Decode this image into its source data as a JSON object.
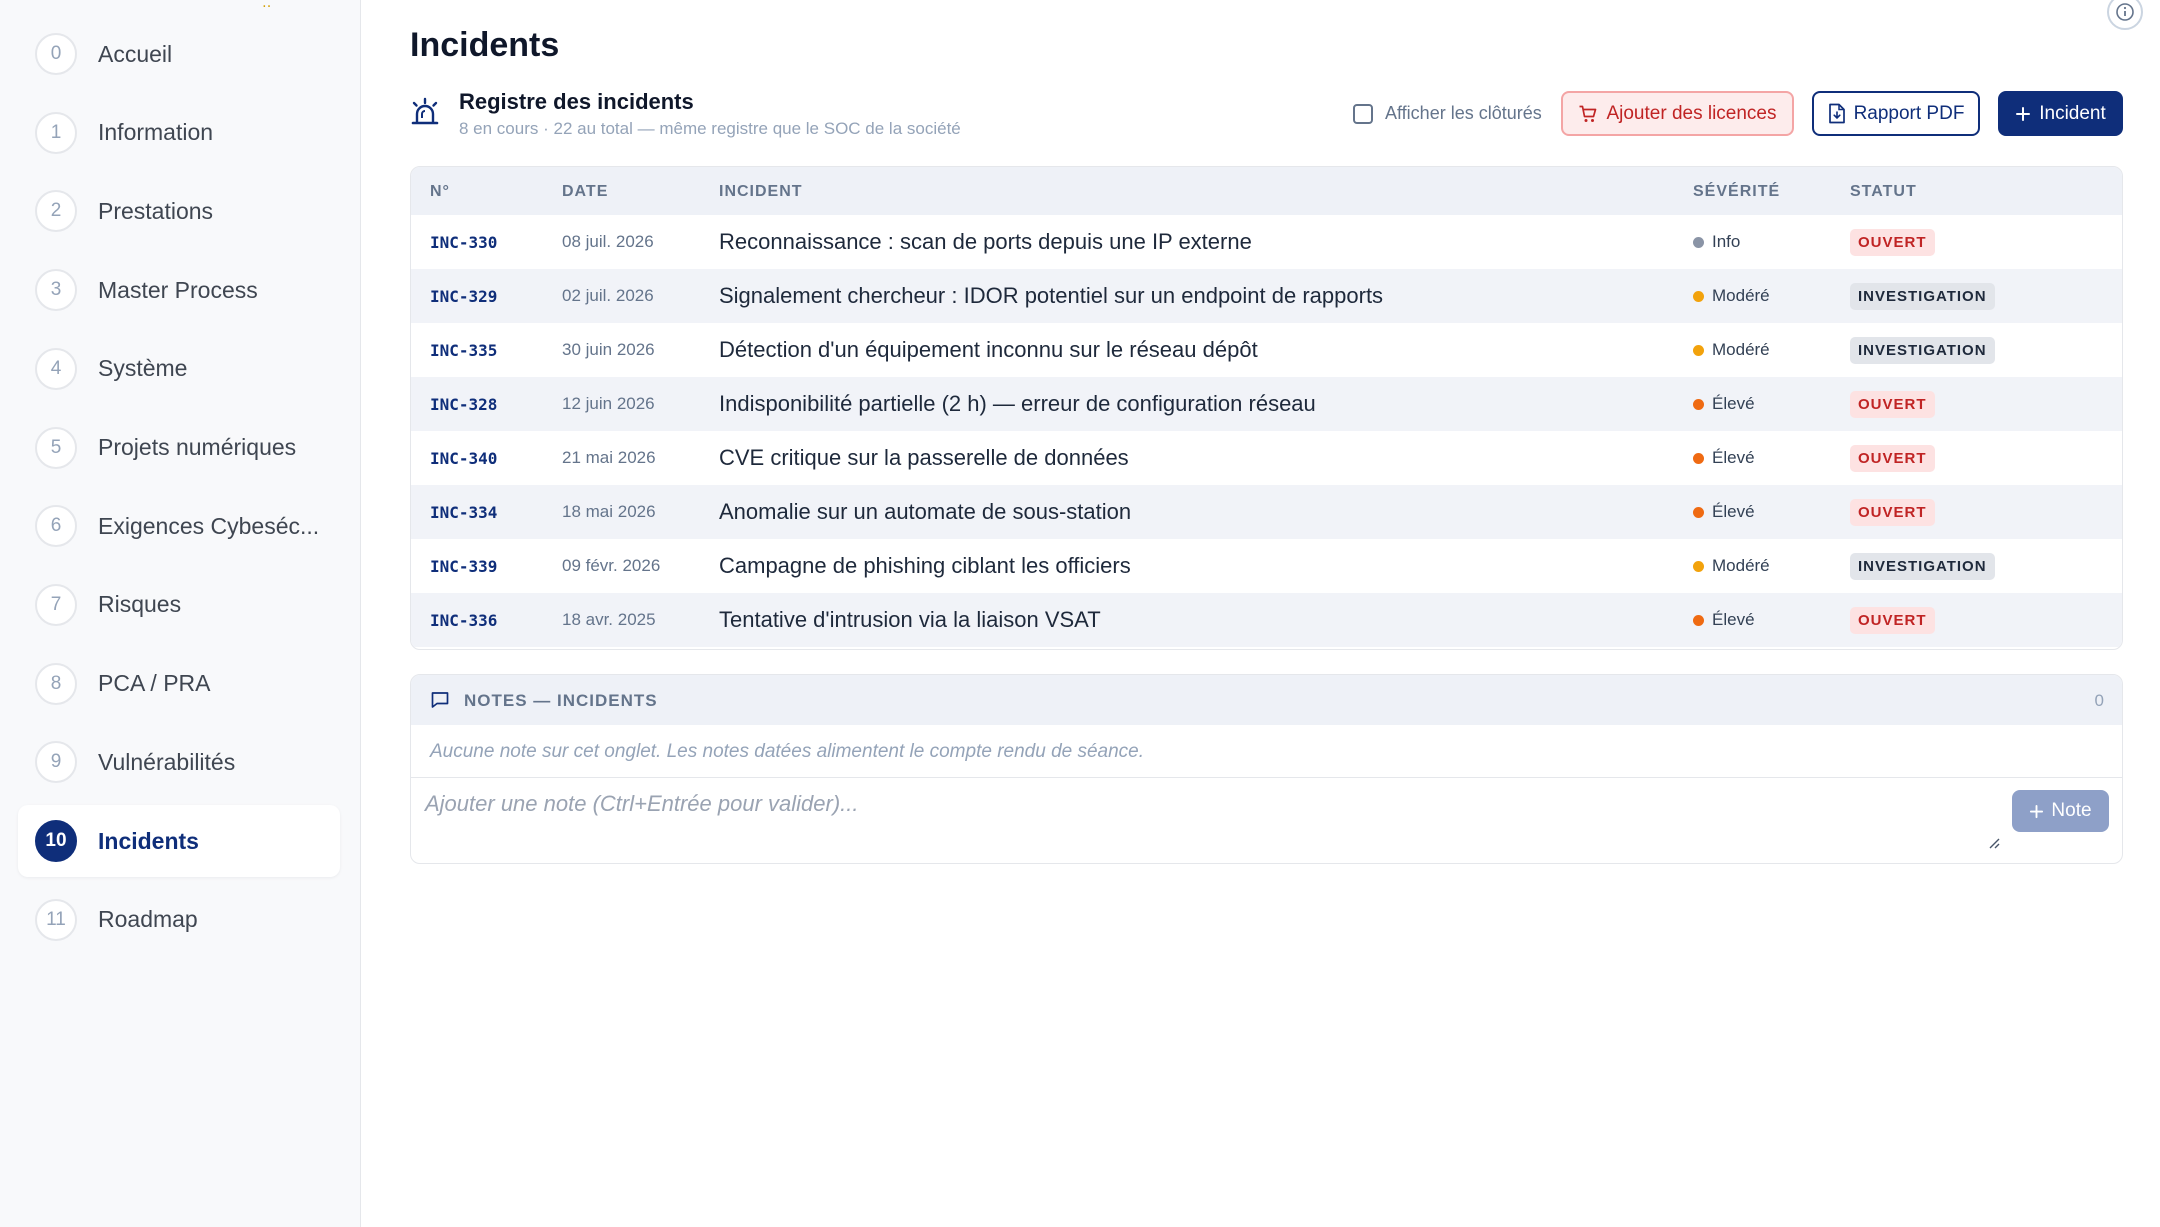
{
  "sidebar": {
    "items": [
      {
        "num": "0",
        "label": "Accueil"
      },
      {
        "num": "1",
        "label": "Information"
      },
      {
        "num": "2",
        "label": "Prestations"
      },
      {
        "num": "3",
        "label": "Master Process"
      },
      {
        "num": "4",
        "label": "Système"
      },
      {
        "num": "5",
        "label": "Projets numériques"
      },
      {
        "num": "6",
        "label": "Exigences Cybeséc..."
      },
      {
        "num": "7",
        "label": "Risques"
      },
      {
        "num": "8",
        "label": "PCA / PRA"
      },
      {
        "num": "9",
        "label": "Vulnérabilités"
      },
      {
        "num": "10",
        "label": "Incidents",
        "active": true
      },
      {
        "num": "11",
        "label": "Roadmap"
      }
    ]
  },
  "page": {
    "title": "Incidents"
  },
  "register": {
    "title": "Registre des incidents",
    "subtitle": "8 en cours · 22 au total — même registre que le SOC de la société",
    "show_closed_label": "Afficher les clôturés",
    "show_closed_checked": false,
    "add_licenses_label": "Ajouter des licences",
    "pdf_label": "Rapport PDF",
    "new_incident_label": "Incident"
  },
  "table": {
    "headers": {
      "id": "N°",
      "date": "DATE",
      "incident": "INCIDENT",
      "severity": "SÉVÉRITÉ",
      "status": "STATUT"
    },
    "rows": [
      {
        "id": "INC-330",
        "date": "08 juil. 2026",
        "incident": "Reconnaissance : scan de ports depuis une IP externe",
        "severity": "Info",
        "severity_color": "#8a94a6",
        "status": "OUVERT",
        "status_kind": "ouvert"
      },
      {
        "id": "INC-329",
        "date": "02 juil. 2026",
        "incident": "Signalement chercheur : IDOR potentiel sur un endpoint de rapports",
        "severity": "Modéré",
        "severity_color": "#f2a20c",
        "status": "INVESTIGATION",
        "status_kind": "investigation"
      },
      {
        "id": "INC-335",
        "date": "30 juin 2026",
        "incident": "Détection d'un équipement inconnu sur le réseau dépôt",
        "severity": "Modéré",
        "severity_color": "#f2a20c",
        "status": "INVESTIGATION",
        "status_kind": "investigation"
      },
      {
        "id": "INC-328",
        "date": "12 juin 2026",
        "incident": "Indisponibilité partielle (2 h) — erreur de configuration réseau",
        "severity": "Élevé",
        "severity_color": "#ef6a12",
        "status": "OUVERT",
        "status_kind": "ouvert"
      },
      {
        "id": "INC-340",
        "date": "21 mai 2026",
        "incident": "CVE critique sur la passerelle de données",
        "severity": "Élevé",
        "severity_color": "#ef6a12",
        "status": "OUVERT",
        "status_kind": "ouvert"
      },
      {
        "id": "INC-334",
        "date": "18 mai 2026",
        "incident": "Anomalie sur un automate de sous-station",
        "severity": "Élevé",
        "severity_color": "#ef6a12",
        "status": "OUVERT",
        "status_kind": "ouvert"
      },
      {
        "id": "INC-339",
        "date": "09 févr. 2026",
        "incident": "Campagne de phishing ciblant les officiers",
        "severity": "Modéré",
        "severity_color": "#f2a20c",
        "status": "INVESTIGATION",
        "status_kind": "investigation"
      },
      {
        "id": "INC-336",
        "date": "18 avr. 2025",
        "incident": "Tentative d'intrusion via la liaison VSAT",
        "severity": "Élevé",
        "severity_color": "#ef6a12",
        "status": "OUVERT",
        "status_kind": "ouvert"
      }
    ]
  },
  "notes": {
    "title": "NOTES — INCIDENTS",
    "count": "0",
    "empty_text": "Aucune note sur cet onglet. Les notes datées alimentent le compte rendu de séance.",
    "input_placeholder": "Ajouter une note (Ctrl+Entrée pour valider)...",
    "input_value": "",
    "add_label": "Note"
  },
  "colors": {
    "accent": "#0f2e7a",
    "danger": "#c02424",
    "sidebar_bg": "#f8f9fb"
  }
}
